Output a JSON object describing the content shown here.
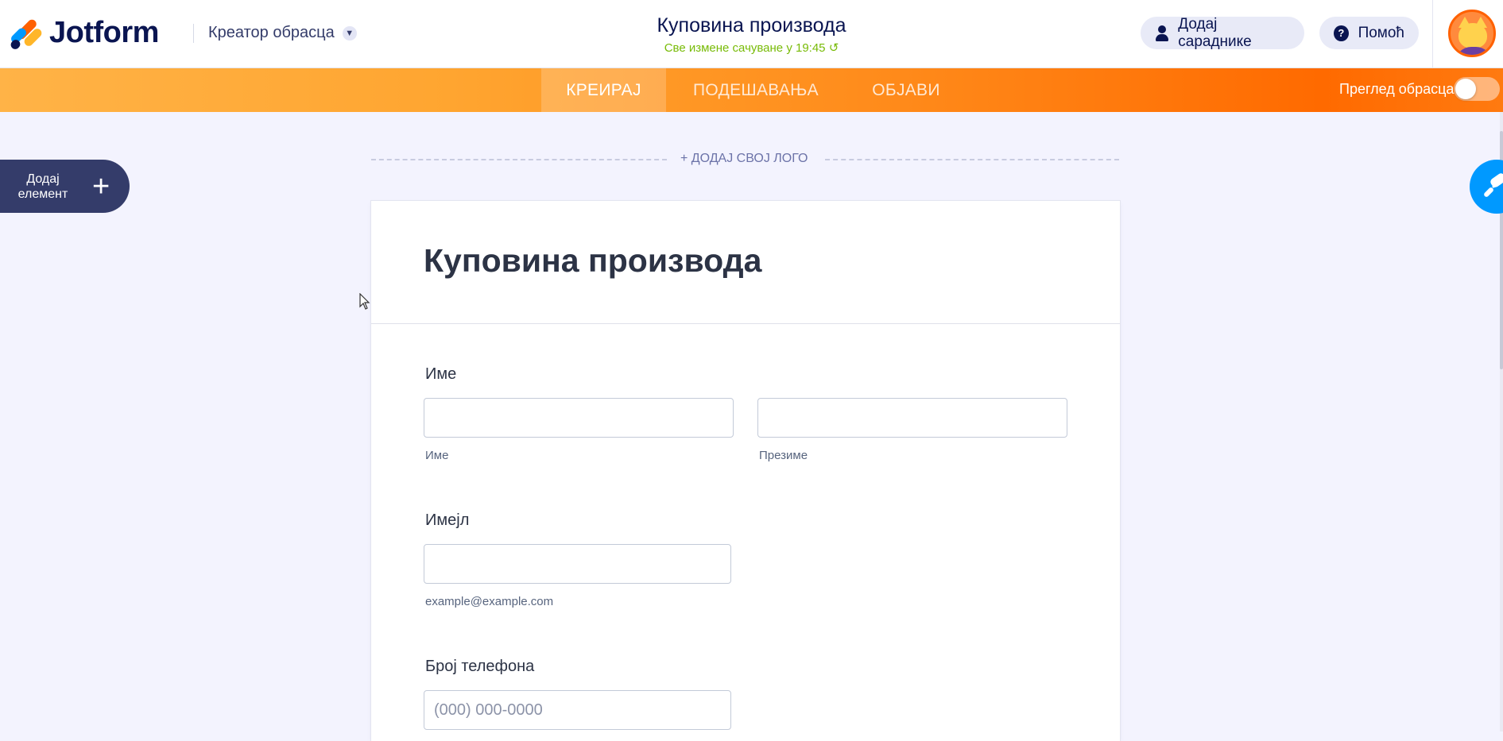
{
  "header": {
    "brand": "Jotform",
    "creator_label": "Креатор обрасца",
    "form_title": "Куповина производа",
    "save_status": "Све измене сачуване у 19:45",
    "add_collaborators": "Додај сараднике",
    "help": "Помоћ"
  },
  "nav": {
    "tabs": [
      {
        "label": "КРЕИРАЈ",
        "active": true
      },
      {
        "label": "ПОДЕШАВАЊА",
        "active": false
      },
      {
        "label": "ОБЈАВИ",
        "active": false
      }
    ],
    "preview_label": "Преглед обрасца",
    "preview_on": false
  },
  "sidebar": {
    "add_element_label": "Додај елемент"
  },
  "form": {
    "add_logo": "+ ДОДАЈ СВОЈ ЛОГО",
    "title": "Куповина производа",
    "fields": {
      "name": {
        "label": "Име",
        "first_sub": "Име",
        "last_sub": "Презиме"
      },
      "email": {
        "label": "Имејл",
        "sub": "example@example.com"
      },
      "phone": {
        "label": "Број телефона",
        "placeholder": "(000) 000-0000"
      }
    }
  },
  "colors": {
    "accent_orange": "#ff6100",
    "save_green": "#78bb07",
    "design_blue": "#0099ff",
    "navy": "#0a1551"
  },
  "icons": {
    "collaborator": "person-icon",
    "help": "question-icon",
    "design": "paint-roller-icon",
    "add": "plus-icon",
    "creator_dropdown": "chevron-down-icon",
    "save_status": "refresh-icon"
  }
}
